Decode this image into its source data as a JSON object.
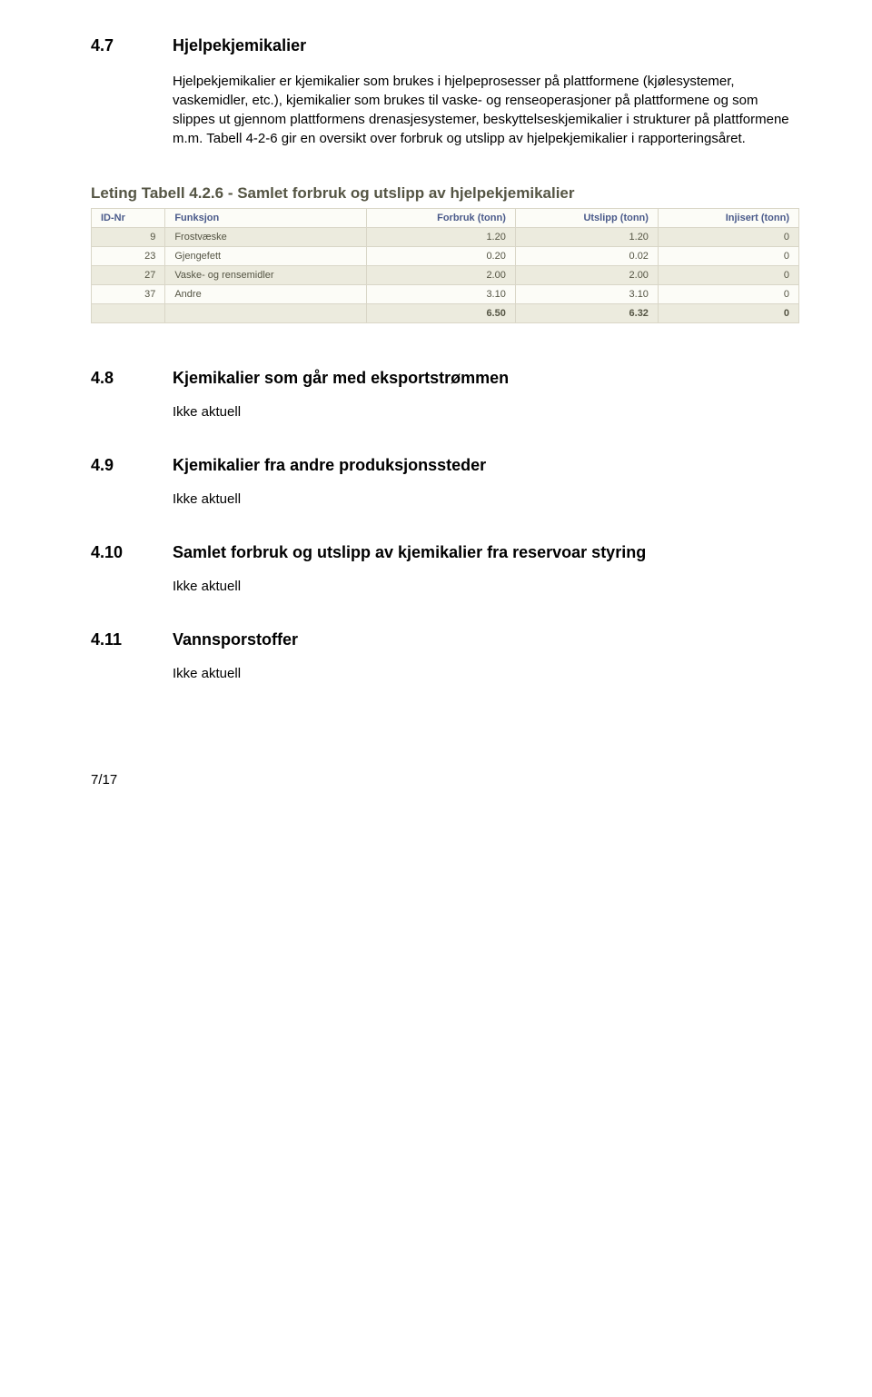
{
  "sections": {
    "s47": {
      "num": "4.7",
      "title": "Hjelpekjemikalier",
      "para1": "Hjelpekjemikalier er kjemikalier som brukes i hjelpeprosesser på plattformene (kjølesystemer, vaskemidler, etc.), kjemikalier som brukes til vaske- og renseoperasjoner på plattformene og som slippes ut gjennom plattformens drenasjesystemer, beskyttelseskjemikalier i strukturer på plattformene m.m. Tabell 4-2-6 gir en oversikt over forbruk og utslipp av hjelpekjemikalier i rapporteringsåret."
    },
    "s48": {
      "num": "4.8",
      "title": "Kjemikalier som går med eksportstrømmen",
      "na": "Ikke aktuell"
    },
    "s49": {
      "num": "4.9",
      "title": "Kjemikalier fra andre produksjonssteder",
      "na": "Ikke aktuell"
    },
    "s410": {
      "num": "4.10",
      "title": "Samlet forbruk og utslipp av kjemikalier fra reservoar styring",
      "na": "Ikke aktuell"
    },
    "s411": {
      "num": "4.11",
      "title": "Vannsporstoffer",
      "na": "Ikke aktuell"
    }
  },
  "table": {
    "title": "Leting Tabell 4.2.6 - Samlet forbruk og utslipp av hjelpekjemikalier",
    "headers": {
      "id": "ID-Nr",
      "funksjon": "Funksjon",
      "forbruk": "Forbruk (tonn)",
      "utslipp": "Utslipp (tonn)",
      "injisert": "Injisert (tonn)"
    },
    "rows": [
      {
        "id": "9",
        "funksjon": "Frostvæske",
        "forbruk": "1.20",
        "utslipp": "1.20",
        "injisert": "0"
      },
      {
        "id": "23",
        "funksjon": "Gjengefett",
        "forbruk": "0.20",
        "utslipp": "0.02",
        "injisert": "0"
      },
      {
        "id": "27",
        "funksjon": "Vaske- og rensemidler",
        "forbruk": "2.00",
        "utslipp": "2.00",
        "injisert": "0"
      },
      {
        "id": "37",
        "funksjon": "Andre",
        "forbruk": "3.10",
        "utslipp": "3.10",
        "injisert": "0"
      }
    ],
    "totals": {
      "forbruk": "6.50",
      "utslipp": "6.32",
      "injisert": "0"
    }
  },
  "pagenum": "7/17",
  "chart_data": {
    "type": "table",
    "title": "Leting Tabell 4.2.6 - Samlet forbruk og utslipp av hjelpekjemikalier",
    "columns": [
      "ID-Nr",
      "Funksjon",
      "Forbruk (tonn)",
      "Utslipp (tonn)",
      "Injisert (tonn)"
    ],
    "rows": [
      [
        9,
        "Frostvæske",
        1.2,
        1.2,
        0
      ],
      [
        23,
        "Gjengefett",
        0.2,
        0.02,
        0
      ],
      [
        27,
        "Vaske- og rensemidler",
        2.0,
        2.0,
        0
      ],
      [
        37,
        "Andre",
        3.1,
        3.1,
        0
      ]
    ],
    "totals": [
      null,
      null,
      6.5,
      6.32,
      0
    ]
  }
}
